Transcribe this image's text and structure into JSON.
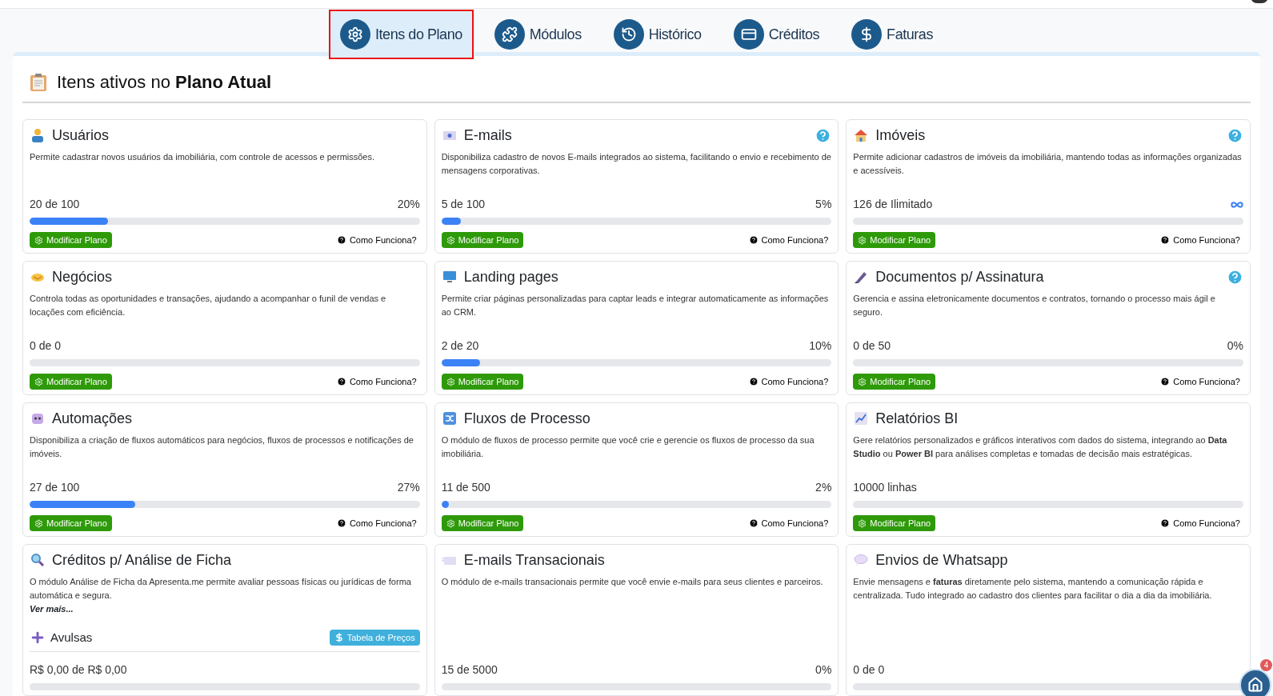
{
  "tabs": [
    {
      "label": "Itens do Plano",
      "selected": true
    },
    {
      "label": "Módulos",
      "selected": false
    },
    {
      "label": "Histórico",
      "selected": false
    },
    {
      "label": "Créditos",
      "selected": false
    },
    {
      "label": "Faturas",
      "selected": false
    }
  ],
  "heading": "Itens ativos no **Plano Atual**",
  "cards": [
    {
      "kind": "usage",
      "title": "Usuários",
      "help": false,
      "description": "Permite cadastrar novos usuários da imobiliária, com controle de acessos e permissões.",
      "usage": "20 de 100",
      "percent": "20%",
      "unlimited": false,
      "level": 0.2,
      "footer": {
        "button": "Modificar Plano",
        "link": "Como Funciona?"
      }
    },
    {
      "kind": "usage",
      "title": "E-mails",
      "help": true,
      "description": "Disponibiliza cadastro de novos E-mails integrados ao sistema, facilitando o envio e recebimento de mensagens corporativas.",
      "usage": "5 de 100",
      "percent": "5%",
      "unlimited": false,
      "level": 0.05,
      "footer": {
        "button": "Modificar Plano",
        "link": "Como Funciona?"
      }
    },
    {
      "kind": "usage",
      "title": "Imóveis",
      "help": true,
      "description": "Permite adicionar cadastros de imóveis da imobiliária, mantendo todas as informações organizadas e acessíveis.",
      "usage": "126 de Ilimitado",
      "unlimited": true,
      "footer": {
        "button": "Modificar Plano",
        "link": "Como Funciona?"
      }
    },
    {
      "kind": "usage",
      "title": "Negócios",
      "help": false,
      "description": "Controla todas as oportunidades e transações, ajudando a acompanhar o funil de vendas e locações com eficiência.",
      "usage": "0 de 0",
      "unlimited": false,
      "footer": {
        "button": "Modificar Plano",
        "link": "Como Funciona?"
      }
    },
    {
      "kind": "usage",
      "title": "Landing pages",
      "help": false,
      "description": "Permite criar páginas personalizadas para captar leads e integrar automaticamente as informações ao CRM.",
      "usage": "2 de 20",
      "percent": "10%",
      "unlimited": false,
      "level": 0.1,
      "footer": {
        "button": "Modificar Plano",
        "link": "Como Funciona?"
      }
    },
    {
      "kind": "usage",
      "title": "Documentos p/ Assinatura",
      "help": true,
      "description": "Gerencia e assina eletronicamente documentos e contratos, tornando o processo mais ágil e seguro.",
      "usage": "0 de 50",
      "percent": "0%",
      "unlimited": false,
      "footer": {
        "button": "Modificar Plano",
        "link": "Como Funciona?"
      }
    },
    {
      "kind": "usage",
      "title": "Automações",
      "help": false,
      "description": "Disponibiliza a criação de fluxos automáticos para negócios, fluxos de processos e notificações de imóveis.",
      "usage": "27 de 100",
      "percent": "27%",
      "unlimited": false,
      "level": 0.27,
      "footer": {
        "button": "Modificar Plano",
        "link": "Como Funciona?"
      }
    },
    {
      "kind": "usage",
      "title": "Fluxos de Processo",
      "help": false,
      "description": "O módulo de fluxos de processo permite que você crie e gerencie os fluxos de processo da sua imobiliária.",
      "usage": "11 de 500",
      "percent": "2%",
      "unlimited": false,
      "level": 0.02,
      "footer": {
        "button": "Modificar Plano",
        "link": "Como Funciona?"
      }
    },
    {
      "kind": "usage",
      "title": "Relatórios BI",
      "help": false,
      "description": "Gere relatórios personalizados e gráficos interativos com dados do sistema, integrando ao **Data Studio** ou **Power BI** para análises completas e tomadas de decisão mais estratégicas.",
      "usage": "10000 linhas",
      "unlimited": false,
      "footer": {
        "button": "Modificar Plano",
        "link": "Como Funciona?"
      }
    },
    {
      "kind": "credits",
      "title": "Créditos p/ Análise de Ficha",
      "help": false,
      "description": "O módulo Análise de Ficha da Apresenta.me permite avaliar pessoas físicas ou jurídicas de forma automática e segura.",
      "more": "Ver mais...",
      "extra": {
        "label": "Avulsas",
        "button": "Tabela de Preços"
      },
      "usage": "R$ 0,00 de R$ 0,00",
      "unlimited": false
    },
    {
      "kind": "usage",
      "title": "E-mails Transacionais",
      "help": false,
      "description": "O módulo de e-mails transacionais permite que você envie e-mails para seus clientes e parceiros.",
      "usage": "15 de 5000",
      "percent": "0%",
      "unlimited": false
    },
    {
      "kind": "usage",
      "title": "Envios de Whatsapp",
      "help": false,
      "description": "Envie mensagens e **faturas** diretamente pelo sistema, mantendo a comunicação rápida e centralizada. Tudo integrado ao cadastro dos clientes para facilitar o dia a dia da imobiliária.",
      "usage": "0 de 0",
      "unlimited": false
    }
  ],
  "fab": {
    "badge": "4"
  }
}
